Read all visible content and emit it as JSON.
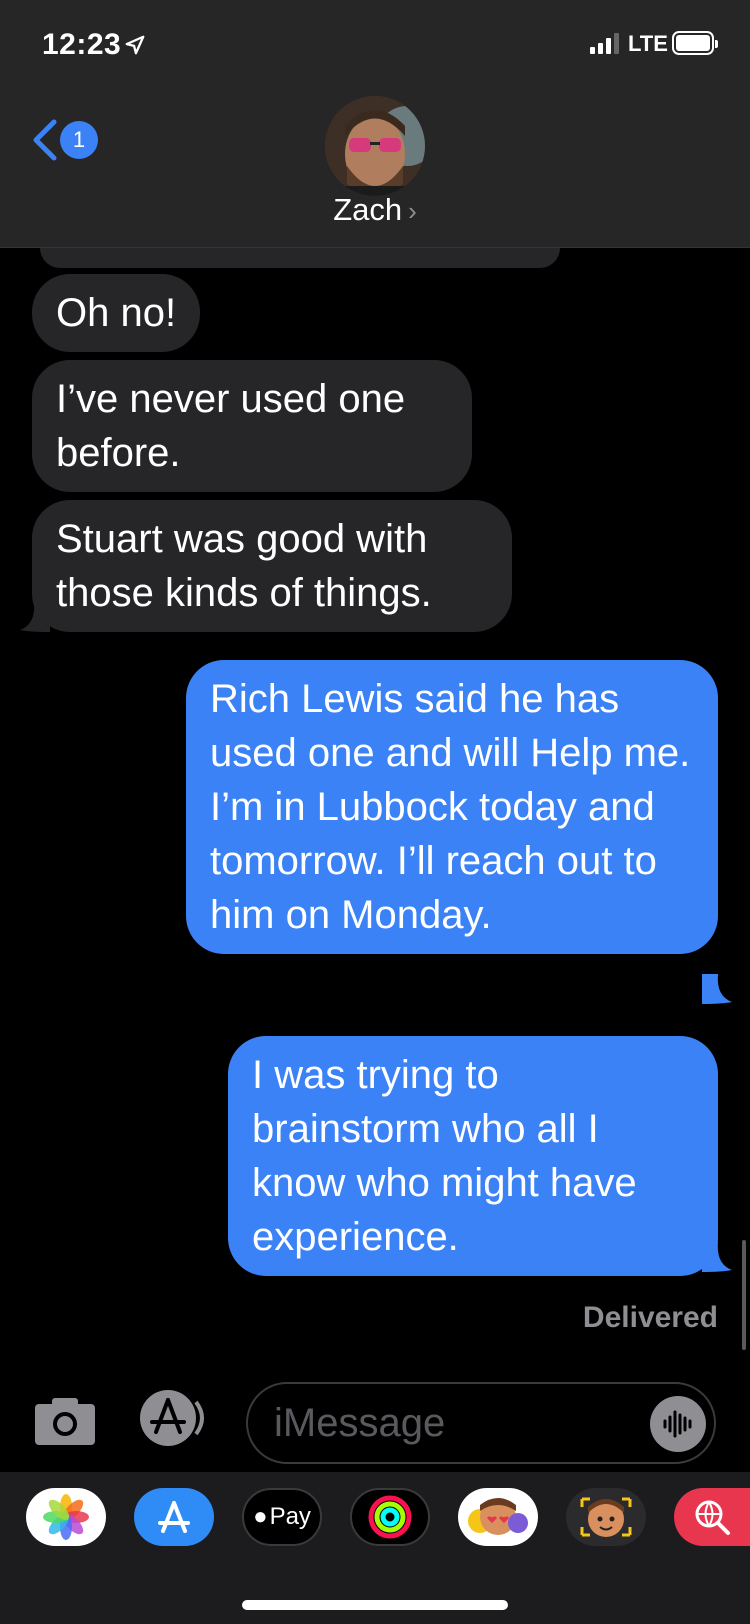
{
  "status_bar": {
    "time": "12:23",
    "network": "LTE"
  },
  "header": {
    "back_badge": "1",
    "contact_name": "Zach",
    "chevron": "›"
  },
  "messages": [
    {
      "direction": "received",
      "text": "Oh no!"
    },
    {
      "direction": "received",
      "text": "I’ve never used one before."
    },
    {
      "direction": "received",
      "text": "Stuart was good with those kinds of things."
    },
    {
      "direction": "sent",
      "text": "Rich Lewis said he has used one and will Help me. I’m in Lubbock today and tomorrow. I’ll reach out to him on Monday."
    },
    {
      "direction": "sent",
      "text": "I was trying to brainstorm who all I know who might have experience."
    }
  ],
  "delivery_status": "Delivered",
  "compose": {
    "placeholder": "iMessage"
  },
  "app_drawer": {
    "apps": [
      {
        "name": "photos-app-icon"
      },
      {
        "name": "app-store-app-icon"
      },
      {
        "name": "apple-pay-app-icon",
        "label": "Pay"
      },
      {
        "name": "activity-app-icon"
      },
      {
        "name": "animoji-app-icon"
      },
      {
        "name": "memoji-app-icon"
      },
      {
        "name": "web-search-app-icon"
      }
    ]
  },
  "colors": {
    "sent_bubble": "#3b82f6",
    "received_bubble": "#262628",
    "header_bg": "#262626"
  }
}
